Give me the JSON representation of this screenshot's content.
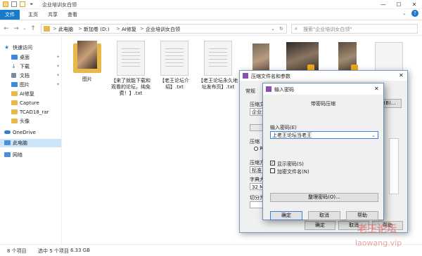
{
  "window": {
    "title": "企业培训女白领"
  },
  "ribbon": {
    "file": "文件",
    "home": "主页",
    "share": "共享",
    "view": "查看"
  },
  "address": {
    "segments": [
      "此电脑",
      "新加卷 (D:)",
      "AI修复",
      "企业培训女白领"
    ],
    "separator": ">",
    "search_placeholder": "搜索\"企业培训女白领\""
  },
  "sidebar": {
    "items": [
      {
        "label": "快速访问",
        "icon": "star-icon",
        "color": "#3c7fd6"
      },
      {
        "label": "桌面",
        "icon": "desktop-icon",
        "color": "#3a8be0",
        "pinned": true
      },
      {
        "label": "下载",
        "icon": "download-icon",
        "color": "#2f7dd8",
        "pinned": true
      },
      {
        "label": "文档",
        "icon": "document-icon",
        "color": "#7a8aa0",
        "pinned": true
      },
      {
        "label": "图片",
        "icon": "picture-icon",
        "color": "#3a8be0",
        "pinned": true
      },
      {
        "label": "AI修复",
        "icon": "folder-icon",
        "color": "#e8b84a"
      },
      {
        "label": "Capture",
        "icon": "folder-icon",
        "color": "#e8b84a"
      },
      {
        "label": "TCAD18_rar",
        "icon": "folder-icon",
        "color": "#e8b84a"
      },
      {
        "label": "头像",
        "icon": "folder-icon",
        "color": "#e8b84a"
      },
      {
        "label": "OneDrive",
        "icon": "cloud-icon",
        "color": "#2f7dd8"
      },
      {
        "label": "此电脑",
        "icon": "computer-icon",
        "color": "#4a90d9",
        "selected": true
      },
      {
        "label": "网络",
        "icon": "network-icon",
        "color": "#4a90d9"
      }
    ]
  },
  "files": [
    {
      "name": "图片",
      "type": "folder"
    },
    {
      "name": "【来了就能下载和观看的论坛，纯免费！】.txt",
      "type": "txt"
    },
    {
      "name": "【老王论坛介绍】.txt",
      "type": "txt"
    },
    {
      "name": "【老王论坛永久地址发布页】.txt",
      "type": "txt"
    }
  ],
  "status": {
    "count": "8 个项目",
    "selection": "选中 5 个项目",
    "size": "6.33 GB"
  },
  "archive_dialog": {
    "title": "压缩文件名和参数",
    "tab_general": "常规",
    "field_archive_label": "压缩文",
    "field_archive_value": "企业培",
    "format_label": "压缩",
    "format_option": "RA",
    "method_label": "压缩方",
    "method_value": "标准",
    "dict_label": "字典大",
    "dict_value": "32 MB",
    "split_label": "切分为",
    "browse_fragment": "(B)...",
    "ok": "确定",
    "cancel": "取消",
    "help": "帮助"
  },
  "password_dialog": {
    "title": "输入密码",
    "heading": "带密码压缩",
    "input_label": "输入密码(E)",
    "input_value": "上老王论坛当老王",
    "show_password": "显示密码(S)",
    "encrypt_names": "加密文件名(N)",
    "manage_button": "整理密码(O)...",
    "ok": "确定",
    "cancel": "取消",
    "help": "帮助"
  },
  "watermark": {
    "title": "老王论坛",
    "url": "laowang.vip"
  },
  "colors": {
    "accent": "#1979ca",
    "selection": "#cce4f7",
    "folder": "#e8b84a"
  }
}
